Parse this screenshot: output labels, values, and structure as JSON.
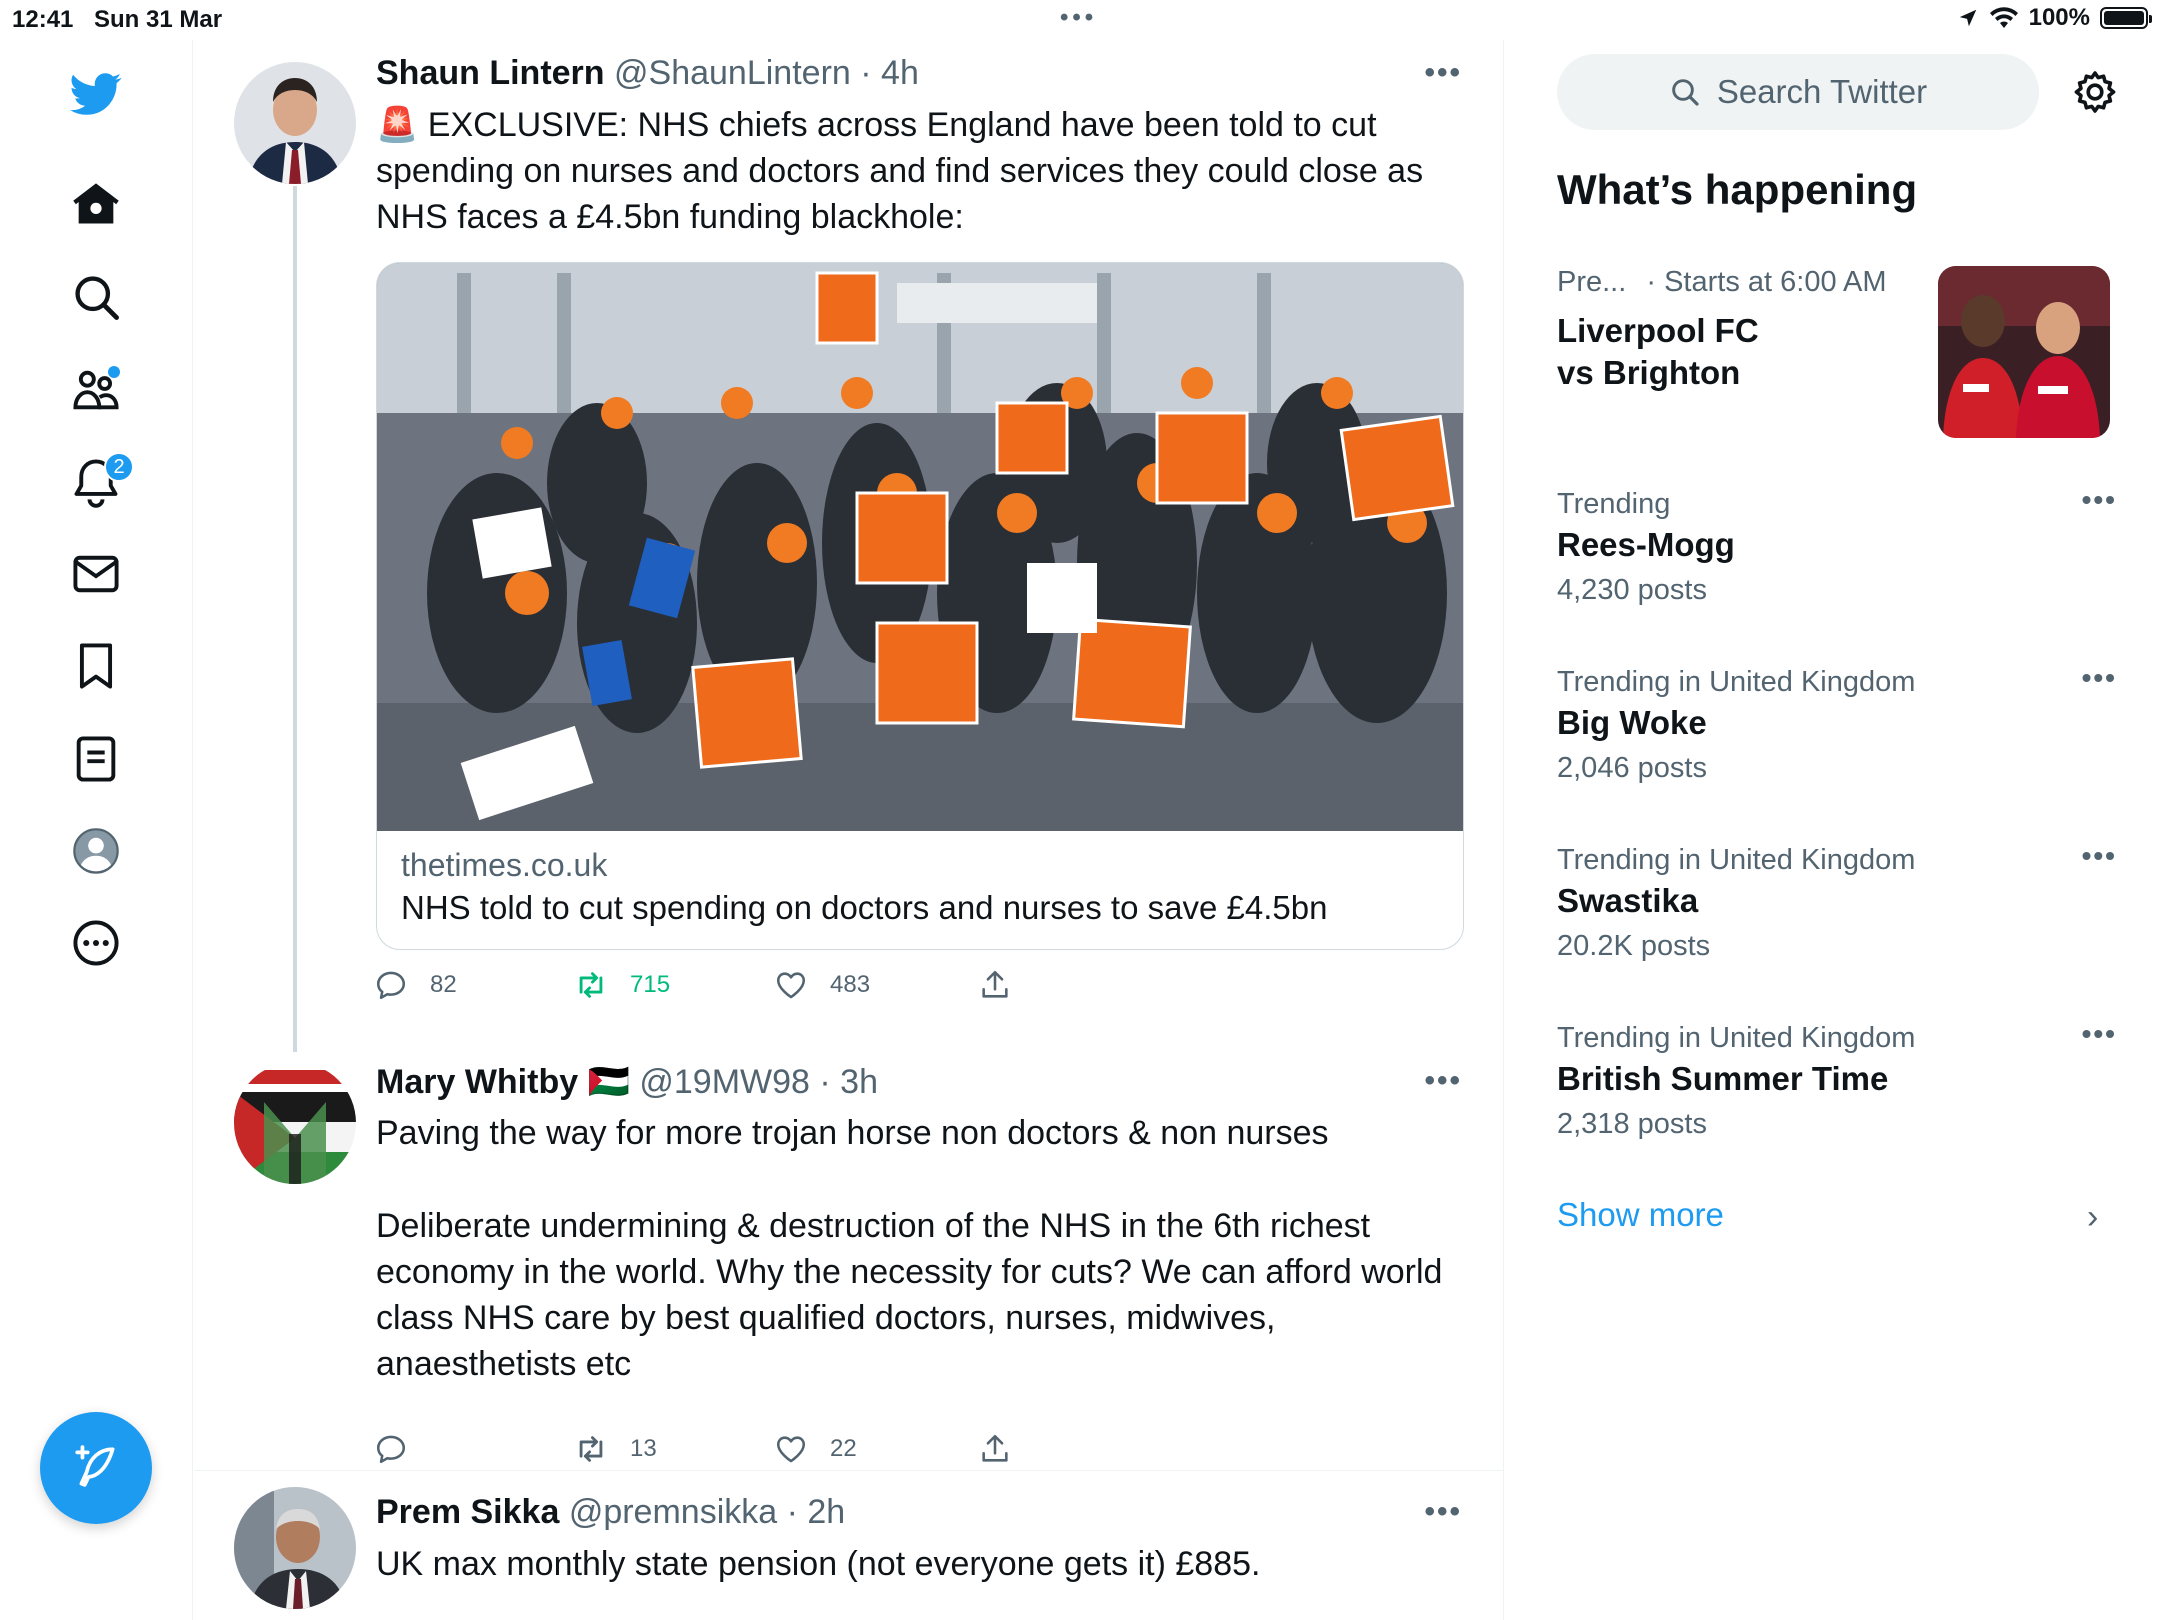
{
  "status_bar": {
    "time": "12:41",
    "date": "Sun 31 Mar",
    "battery": "100%"
  },
  "nav": {
    "notifications_count": "2",
    "items": [
      "home-icon",
      "search-icon",
      "communities-icon",
      "notifications-icon",
      "messages-icon",
      "bookmarks-icon",
      "lists-icon",
      "profile-icon",
      "more-icon"
    ]
  },
  "colors": {
    "accent": "#1d9bf0",
    "retweet_green": "#00ba7c",
    "secondary_text": "#536471"
  },
  "tweets": [
    {
      "name": "Shaun Lintern",
      "handle": "@ShaunLintern",
      "time": "· 4h",
      "text": "🚨 EXCLUSIVE: NHS chiefs across England have been told to cut spending on nurses and doctors and find services they could close as NHS faces a £4.5bn funding blackhole:",
      "card": {
        "domain": "thetimes.co.uk",
        "title": "NHS told to cut spending on doctors and nurses to save £4.5bn"
      },
      "replies": "82",
      "retweets": "715",
      "likes": "483"
    },
    {
      "name": "Mary Whitby 🇵🇸",
      "handle": "@19MW98",
      "time": "· 3h",
      "text_p1": "Paving the way for more trojan horse non doctors & non nurses",
      "text_p2": "Deliberate undermining & destruction of the NHS in the 6th richest economy in the world. Why the necessity for cuts? We can afford world class NHS care by best qualified doctors, nurses, midwives, anaesthetists etc",
      "replies": "",
      "retweets": "13",
      "likes": "22"
    },
    {
      "name": "Prem Sikka",
      "handle": "@premnsikka",
      "time": "· 2h",
      "text": "UK max monthly state pension (not everyone gets it) £885."
    }
  ],
  "sidebar": {
    "search_placeholder": "Search Twitter",
    "section_title": "What’s happening",
    "event": {
      "context": "Pre...",
      "starts": "· Starts at 6:00 AM",
      "title": "Liverpool FC vs Brighton"
    },
    "trends": [
      {
        "context": "Trending",
        "title": "Rees-Mogg",
        "count": "4,230 posts"
      },
      {
        "context": "Trending in United Kingdom",
        "title": "Big Woke",
        "count": "2,046 posts"
      },
      {
        "context": "Trending in United Kingdom",
        "title": "Swastika",
        "count": "20.2K posts"
      },
      {
        "context": "Trending in United Kingdom",
        "title": "British Summer Time",
        "count": "2,318 posts"
      }
    ],
    "show_more": "Show more"
  }
}
